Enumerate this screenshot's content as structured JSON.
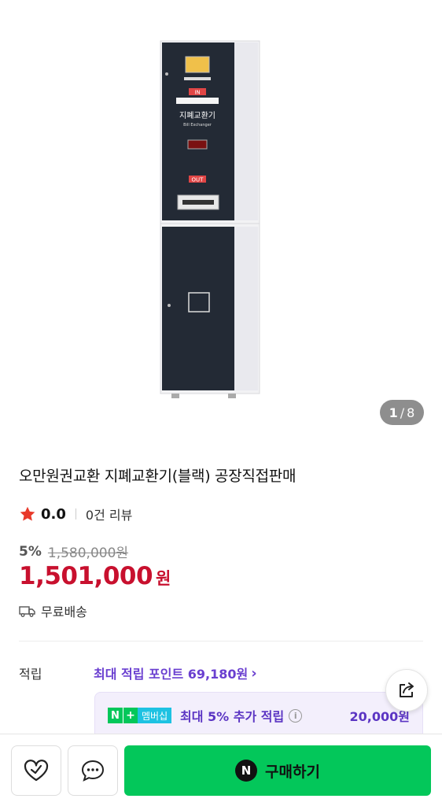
{
  "gallery": {
    "current_page": "1",
    "separator": "/",
    "total_pages": "8"
  },
  "product": {
    "title": "오만원권교환 지폐교환기(블랙) 공장직접판매",
    "rating": "0.0",
    "review_count": "0건 리뷰",
    "discount_pct": "5%",
    "original_price": "1,580,000원",
    "price": "1,501,000",
    "price_unit": "원",
    "shipping": "무료배송"
  },
  "device": {
    "in_label": "IN",
    "name_ko": "지폐교환기",
    "name_en": "Bill Exchanger",
    "out_label": "OUT"
  },
  "points": {
    "label": "적립",
    "max_points": "최대 적립 포인트 69,180원",
    "membership_badge": {
      "n": "N",
      "plus": "+",
      "text": "멤버십"
    },
    "extra_text": "최대 5% 추가 적립",
    "extra_amount": "20,000원"
  },
  "bottom_bar": {
    "buy_label": "구매하기",
    "buy_logo": "N"
  },
  "colors": {
    "accent_green": "#03c75a",
    "price_red": "#c8102e",
    "point_purple": "#6a3fd0",
    "star": "#e8392a"
  },
  "icons": [
    "star-icon",
    "truck-icon",
    "info-icon",
    "share-icon",
    "heart-icon",
    "chat-icon",
    "chevron-right-icon"
  ]
}
